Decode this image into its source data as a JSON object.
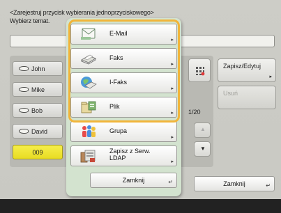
{
  "header": {
    "title": "<Zarejestruj przycisk wybierania jednoprzyciskowego>",
    "subtitle": "Wybierz temat."
  },
  "contacts": [
    {
      "label": "John",
      "icon": "contact-card-icon"
    },
    {
      "label": "Mike",
      "icon": "contact-card-icon"
    },
    {
      "label": "Bob",
      "icon": "contact-card-icon"
    },
    {
      "label": "David",
      "icon": "contact-card-icon"
    },
    {
      "label": "009",
      "icon": ""
    }
  ],
  "right_panel": {
    "save_edit_label": "Zapisz/Edytuj",
    "delete_label": "Usuń",
    "page_indicator": "1/20",
    "close_label": "Zamknij"
  },
  "menu": {
    "items": [
      {
        "label": "E-Mail",
        "icon": "email-icon"
      },
      {
        "label": "Faks",
        "icon": "fax-icon"
      },
      {
        "label": "I-Faks",
        "icon": "ifax-icon"
      },
      {
        "label": "Plik",
        "icon": "file-icon"
      },
      {
        "label": "Grupa",
        "icon": "group-icon"
      },
      {
        "label_line1": "Zapisz z Serw.",
        "label_line2": "LDAP",
        "icon": "ldap-icon"
      }
    ],
    "close_label": "Zamknij"
  },
  "colors": {
    "highlight": "#f1b53a",
    "menu_bg": "#d3e3cf",
    "selected_contact": "#f0e63a"
  }
}
